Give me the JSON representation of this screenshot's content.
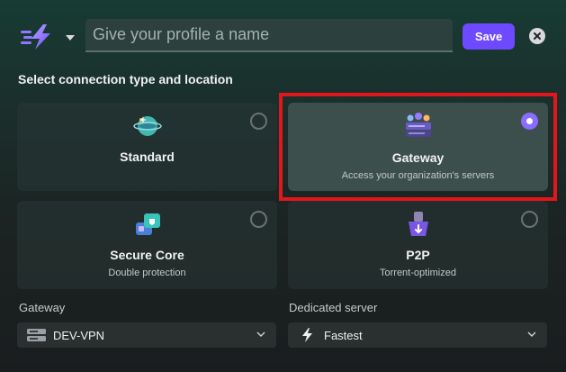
{
  "header": {
    "profile_name_placeholder": "Give your profile a name",
    "save_label": "Save",
    "profile_icon": "lightning-bolt-icon",
    "close_icon": "close-icon"
  },
  "section_title": "Select connection type and location",
  "connection_types": [
    {
      "title": "Standard",
      "subtitle": "",
      "icon": "globe-icon",
      "selected": false
    },
    {
      "title": "Gateway",
      "subtitle": "Access your organization's servers",
      "icon": "gateway-servers-icon",
      "selected": true
    },
    {
      "title": "Secure Core",
      "subtitle": "Double protection",
      "icon": "secure-core-icon",
      "selected": false
    },
    {
      "title": "P2P",
      "subtitle": "Torrent-optimized",
      "icon": "p2p-icon",
      "selected": false
    }
  ],
  "gateway_select": {
    "label": "Gateway",
    "value": "DEV-VPN",
    "icon": "server-icon"
  },
  "server_select": {
    "label": "Dedicated server",
    "value": "Fastest",
    "icon": "bolt-icon"
  },
  "colors": {
    "accent": "#6d4aff",
    "highlight": "#e3161b"
  }
}
